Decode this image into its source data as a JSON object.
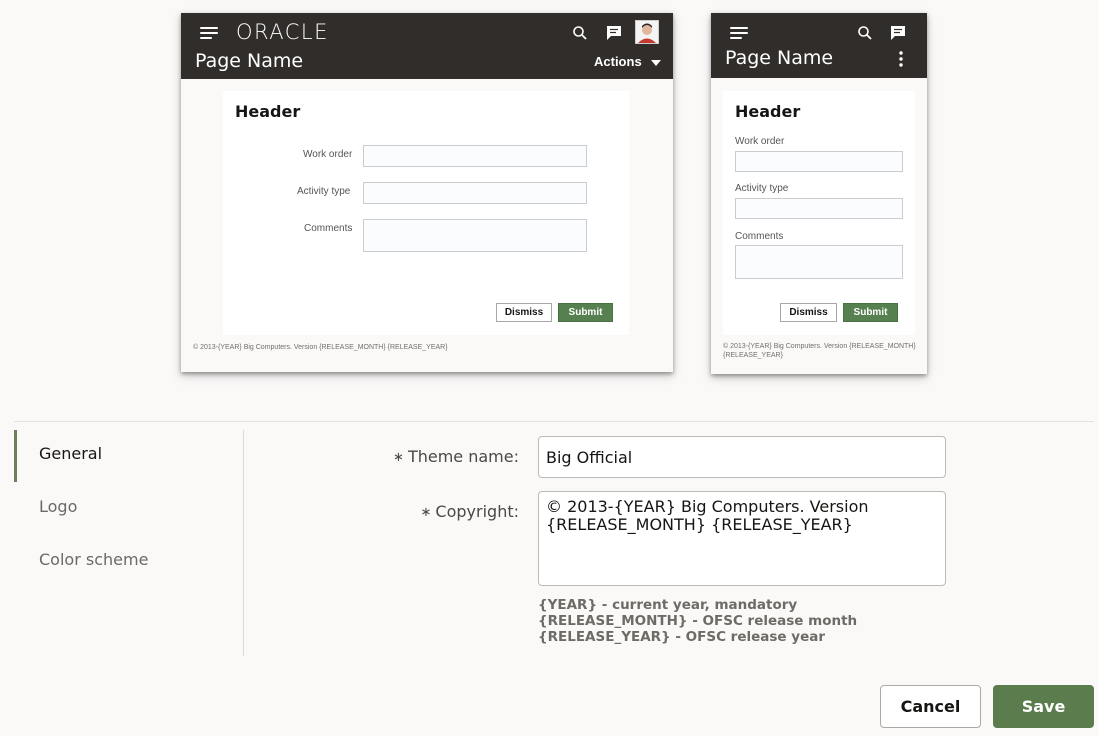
{
  "colors": {
    "header_bg": "#312d2a",
    "submit_green": "#56804f",
    "save_green": "#5b7d4e",
    "active_nav_indicator": "#6b7f5c"
  },
  "preview_desktop": {
    "logo": "ORACLE",
    "page_name": "Page Name",
    "actions_label": "Actions",
    "icons": [
      "menu-icon",
      "search-icon",
      "chat-icon",
      "avatar"
    ],
    "panel_title": "Header",
    "fields": [
      {
        "label": "Work order"
      },
      {
        "label": "Activity type"
      },
      {
        "label": "Comments"
      }
    ],
    "dismiss_label": "Dismiss",
    "submit_label": "Submit",
    "footer": "© 2013-{YEAR} Big Computers. Version {RELEASE_MONTH} {RELEASE_YEAR}"
  },
  "preview_mobile": {
    "page_name": "Page Name",
    "icons": [
      "menu-icon",
      "search-icon",
      "chat-icon",
      "more-vertical-icon"
    ],
    "panel_title": "Header",
    "fields": [
      {
        "label": "Work order"
      },
      {
        "label": "Activity type"
      },
      {
        "label": "Comments"
      }
    ],
    "dismiss_label": "Dismiss",
    "submit_label": "Submit",
    "footer": "© 2013-{YEAR} Big Computers. Version {RELEASE_MONTH} {RELEASE_YEAR}"
  },
  "nav": {
    "items": [
      {
        "label": "General",
        "active": true
      },
      {
        "label": "Logo",
        "active": false
      },
      {
        "label": "Color scheme",
        "active": false
      }
    ]
  },
  "form": {
    "required_marker": "∗",
    "theme_name_label": "Theme name:",
    "theme_name_value": "Big Official",
    "copyright_label": "Copyright:",
    "copyright_value": "© 2013-{YEAR} Big Computers. Version {RELEASE_MONTH} {RELEASE_YEAR}",
    "help_lines": [
      "{YEAR} - current year, mandatory",
      "{RELEASE_MONTH} - OFSC release month",
      "{RELEASE_YEAR} - OFSC release year"
    ]
  },
  "footer_buttons": {
    "cancel_label": "Cancel",
    "save_label": "Save"
  }
}
